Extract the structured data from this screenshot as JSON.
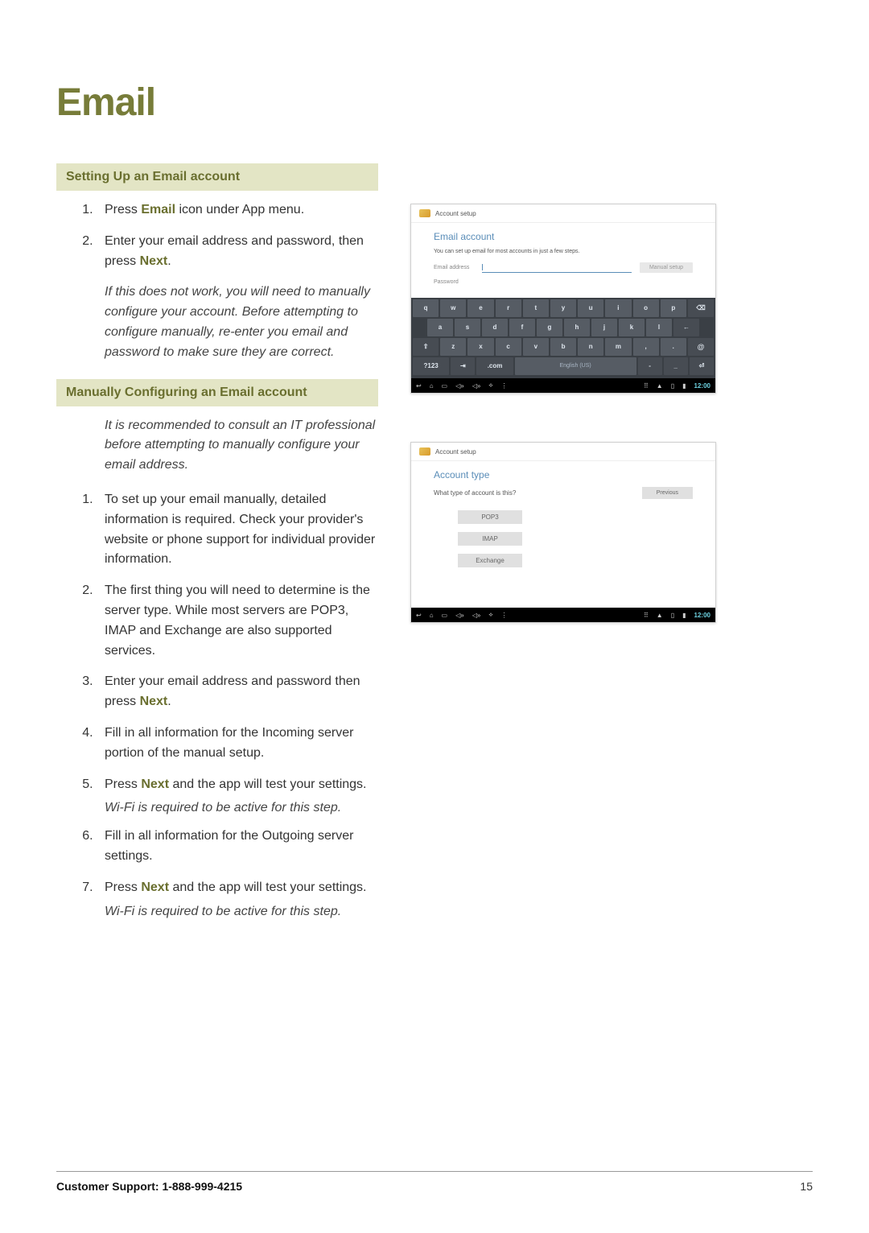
{
  "page": {
    "title": "Email",
    "number": "15",
    "footer_support": "Customer Support: 1-888-999-4215"
  },
  "section1": {
    "heading": "Setting Up an Email account",
    "steps": [
      {
        "pre": "Press ",
        "hl": "Email",
        "post": " icon under App menu."
      },
      {
        "pre": "Enter your email address and password, then press ",
        "hl": "Next",
        "post": "."
      }
    ],
    "note": "If this does not work, you will need to manually configure your account. Before attempting to configure manually, re-enter you email and password to make sure they are correct."
  },
  "section2": {
    "heading": "Manually Configuring an Email account",
    "intro": "It is recommended to consult an IT professional before attempting to manually configure your email address.",
    "steps": {
      "s1": "To set up your email manually, detailed information is required. Check your provider's website or phone support for individual provider information.",
      "s2": "The first thing you will need to determine is the server type. While most servers are POP3, IMAP and Exchange are also supported services.",
      "s3_pre": "Enter your email address and password then press ",
      "s3_hl": "Next",
      "s3_post": ".",
      "s4": "Fill in all information for the Incoming server portion of the manual setup.",
      "s5_pre": "Press ",
      "s5_hl": "Next",
      "s5_post": " and the app will test your settings.",
      "s5_note": "Wi-Fi is required to be active for this step.",
      "s6": "Fill in all information for the Outgoing server settings.",
      "s7_pre": "Press ",
      "s7_hl": "Next",
      "s7_post": " and the app will test your settings.",
      "s7_note": "Wi-Fi is required to be active for this step."
    }
  },
  "shot1": {
    "crumb": "Account setup",
    "title": "Email account",
    "sub": "You can set up email for most accounts in just a few steps.",
    "email_label": "Email address",
    "pass_label": "Password",
    "manual_btn": "Manual setup",
    "space_label": "English (US)",
    "time": "12:00",
    "kbd": {
      "r1": [
        "q",
        "w",
        "e",
        "r",
        "t",
        "y",
        "u",
        "i",
        "o",
        "p",
        "⌫"
      ],
      "r2": [
        "a",
        "s",
        "d",
        "f",
        "g",
        "h",
        "j",
        "k",
        "l",
        "←"
      ],
      "r3": [
        "⇧",
        "z",
        "x",
        "c",
        "v",
        "b",
        "n",
        "m",
        ",",
        ".",
        "@"
      ],
      "r4_sym": "?123",
      "r4_tab": "⇥",
      "r4_com": ".com",
      "r4_dash": "-",
      "r4_under": "_",
      "r4_enter": "⏎"
    }
  },
  "shot2": {
    "crumb": "Account setup",
    "title": "Account type",
    "question": "What type of account is this?",
    "prev": "Previous",
    "opts": [
      "POP3",
      "IMAP",
      "Exchange"
    ],
    "time": "12:00"
  }
}
